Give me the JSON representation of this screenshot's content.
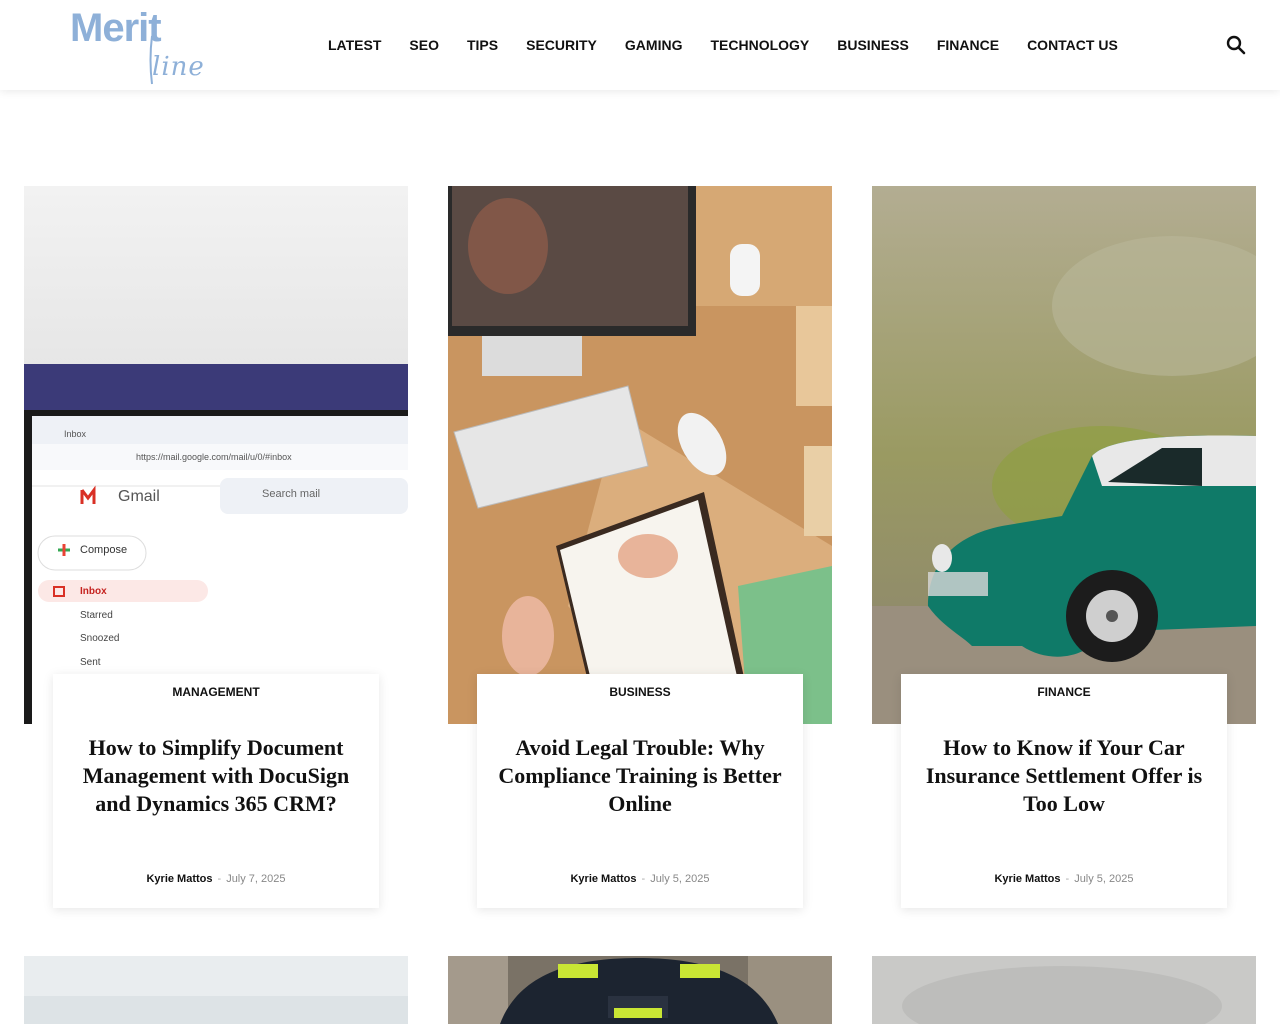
{
  "site": {
    "logo_word_1": "Merit",
    "logo_word_2": "line",
    "brand_color": "#8eb0d8"
  },
  "nav": {
    "items": [
      "LATEST",
      "SEO",
      "TIPS",
      "SECURITY",
      "GAMING",
      "TECHNOLOGY",
      "BUSINESS",
      "FINANCE",
      "CONTACT US"
    ],
    "search_icon": "search-icon"
  },
  "gmail_screenshot": {
    "tab": "Inbox",
    "url": "https://mail.google.com/mail/u/0/#inbox",
    "app": "Gmail",
    "search_placeholder": "Search mail",
    "compose": "Compose",
    "folders": [
      "Inbox",
      "Starred",
      "Snoozed",
      "Sent"
    ]
  },
  "posts": [
    {
      "category": "MANAGEMENT",
      "title": "How to Simplify Document Management with DocuSign and Dynamics 365 CRM?",
      "author": "Kyrie Mattos",
      "separator": "-",
      "date": "July 7, 2025"
    },
    {
      "category": "BUSINESS",
      "title": "Avoid Legal Trouble: Why Compliance Training is Better Online",
      "author": "Kyrie Mattos",
      "separator": "-",
      "date": "July 5, 2025"
    },
    {
      "category": "FINANCE",
      "title": "How to Know if Your Car Insurance Settlement Offer is Too Low",
      "author": "Kyrie Mattos",
      "separator": "-",
      "date": "July 5, 2025"
    }
  ]
}
